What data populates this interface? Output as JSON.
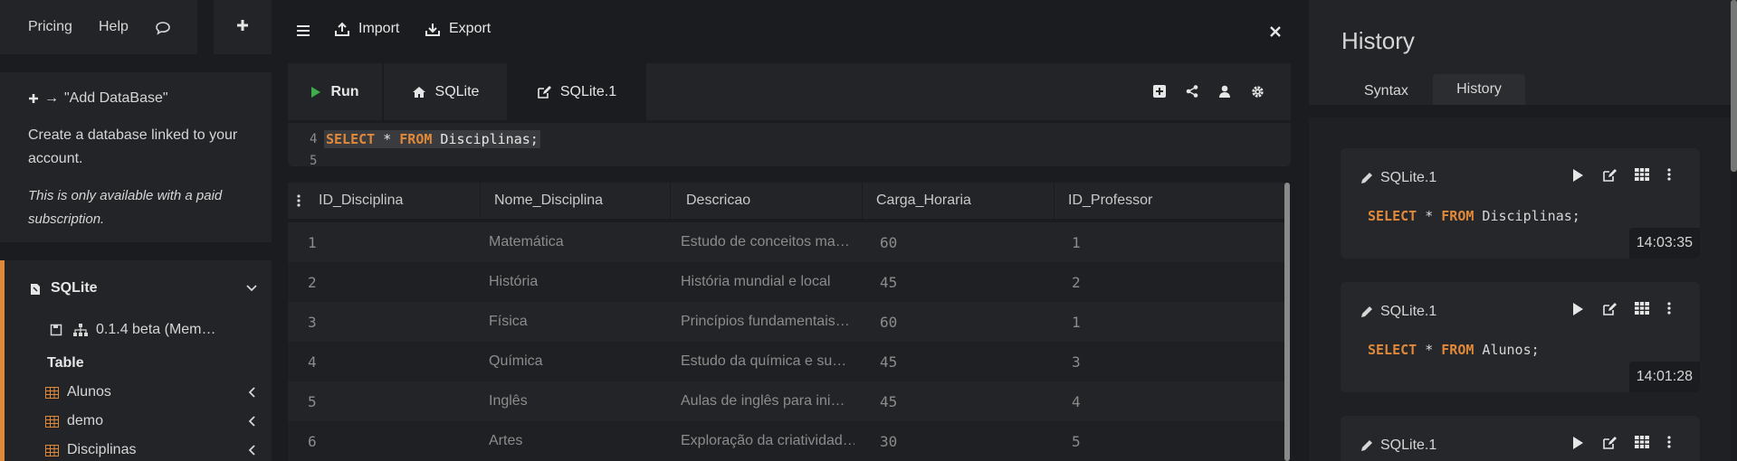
{
  "topnav": {
    "pricing": "Pricing",
    "help": "Help"
  },
  "add_db": {
    "title": "\"Add DataBase\"",
    "desc": "Create a database linked to your account.",
    "note": "This is only available with a paid subscription."
  },
  "tree": {
    "db_name": "SQLite",
    "version": "0.1.4 beta (Mem…",
    "section": "Table",
    "tables": [
      "Alunos",
      "demo",
      "Disciplinas"
    ]
  },
  "toolbar": {
    "import": "Import",
    "export": "Export"
  },
  "tabs": {
    "run": "Run",
    "db_tab": "SQLite",
    "query_tab": "SQLite.1"
  },
  "editor": {
    "line4": "4",
    "line5": "5",
    "kw_select": "SELECT",
    "star": " * ",
    "kw_from": "FROM",
    "rest": " Disciplinas;"
  },
  "grid": {
    "columns": [
      "ID_Disciplina",
      "Nome_Disciplina",
      "Descricao",
      "Carga_Horaria",
      "ID_Professor"
    ],
    "rows": [
      [
        "1",
        "Matemática",
        "Estudo de conceitos ma…",
        "60",
        "1"
      ],
      [
        "2",
        "História",
        "História mundial e local",
        "45",
        "2"
      ],
      [
        "3",
        "Física",
        "Princípios fundamentais…",
        "60",
        "1"
      ],
      [
        "4",
        "Química",
        "Estudo da química e su…",
        "45",
        "3"
      ],
      [
        "5",
        "Inglês",
        "Aulas de inglês para ini…",
        "45",
        "4"
      ],
      [
        "6",
        "Artes",
        "Exploração da criatividad…",
        "30",
        "5"
      ]
    ]
  },
  "history": {
    "title": "History",
    "tab_syntax": "Syntax",
    "tab_history": "History",
    "items": [
      {
        "name": "SQLite.1",
        "sql_kw1": "SELECT",
        "sql_mid": " * ",
        "sql_kw2": "FROM",
        "sql_rest": " Disciplinas;",
        "time": "14:03:35"
      },
      {
        "name": "SQLite.1",
        "sql_kw1": "SELECT",
        "sql_mid": " * ",
        "sql_kw2": "FROM",
        "sql_rest": " Alunos;",
        "time": "14:01:28"
      },
      {
        "name": "SQLite.1"
      }
    ]
  },
  "colors": {
    "accent": "#e0893a",
    "run_green": "#3fae4a",
    "background": "#1b1c1f",
    "panel": "#232427"
  }
}
